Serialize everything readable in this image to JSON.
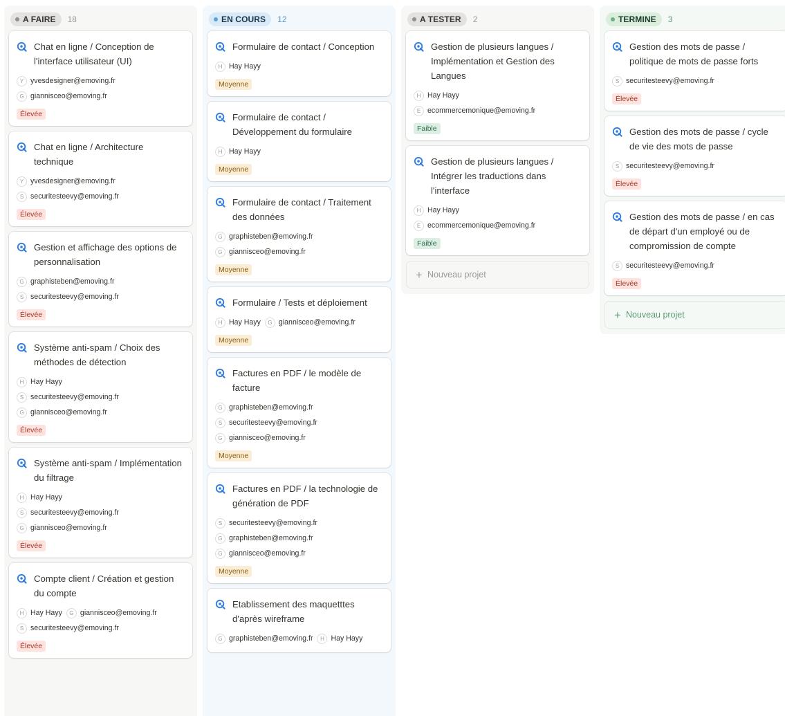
{
  "colors": {
    "task_icon": "#2f7de1",
    "todo": {
      "column_bg": "#f7f7f5",
      "pill_bg": "#e3e2e0",
      "pill_text": "#37352f",
      "dot": "#91918e",
      "count": "#9b9a97"
    },
    "inprogress": {
      "column_bg": "#f3f8fd",
      "pill_bg": "#d8e9f7",
      "pill_text": "#183347",
      "dot": "#5ba3df",
      "count": "#5a95c6"
    },
    "totest": {
      "column_bg": "#f7f7f5",
      "pill_bg": "#e3e2e0",
      "pill_text": "#37352f",
      "dot": "#91918e",
      "count": "#9b9a97"
    },
    "done": {
      "column_bg": "#f5f9f6",
      "pill_bg": "#dbeddb",
      "pill_text": "#1c3829",
      "dot": "#6cb287",
      "count": "#5e9a72"
    }
  },
  "columns": [
    {
      "id": "todo",
      "label": "A FAIRE",
      "count": "18",
      "cards": [
        {
          "title": "Chat en ligne / Conception de l'interface utilisateur (UI)",
          "people": [
            [
              {
                "initial": "Y",
                "name": "yvesdesigner@emoving.fr"
              }
            ],
            [
              {
                "initial": "G",
                "name": "giannisceo@emoving.fr"
              }
            ]
          ],
          "priority": "Élevée",
          "level": "high"
        },
        {
          "title": "Chat en ligne / Architecture technique",
          "people": [
            [
              {
                "initial": "Y",
                "name": "yvesdesigner@emoving.fr"
              }
            ],
            [
              {
                "initial": "S",
                "name": "securitesteevy@emoving.fr"
              }
            ]
          ],
          "priority": "Élevée",
          "level": "high"
        },
        {
          "title": "Gestion et affichage des options de personnalisation",
          "people": [
            [
              {
                "initial": "G",
                "name": "graphisteben@emoving.fr"
              }
            ],
            [
              {
                "initial": "S",
                "name": "securitesteevy@emoving.fr"
              }
            ]
          ],
          "priority": "Élevée",
          "level": "high"
        },
        {
          "title": "Système anti-spam / Choix des méthodes de détection",
          "people": [
            [
              {
                "initial": "H",
                "name": "Hay Hayy"
              }
            ],
            [
              {
                "initial": "S",
                "name": "securitesteevy@emoving.fr"
              }
            ],
            [
              {
                "initial": "G",
                "name": "giannisceo@emoving.fr"
              }
            ]
          ],
          "priority": "Élevée",
          "level": "high"
        },
        {
          "title": "Système anti-spam / Implémentation du filtrage",
          "people": [
            [
              {
                "initial": "H",
                "name": "Hay Hayy"
              }
            ],
            [
              {
                "initial": "S",
                "name": "securitesteevy@emoving.fr"
              }
            ],
            [
              {
                "initial": "G",
                "name": "giannisceo@emoving.fr"
              }
            ]
          ],
          "priority": "Élevée",
          "level": "high"
        },
        {
          "title": "Compte client / Création et gestion du compte",
          "people": [
            [
              {
                "initial": "H",
                "name": "Hay Hayy"
              },
              {
                "initial": "G",
                "name": "giannisceo@emoving.fr"
              }
            ],
            [
              {
                "initial": "S",
                "name": "securitesteevy@emoving.fr"
              }
            ]
          ],
          "priority": "Élevée",
          "level": "high"
        }
      ],
      "new_project": ""
    },
    {
      "id": "inprogress",
      "label": "EN COURS",
      "count": "12",
      "cards": [
        {
          "title": "Formulaire de contact / Conception",
          "people": [
            [
              {
                "initial": "H",
                "name": "Hay Hayy"
              }
            ]
          ],
          "priority": "Moyenne",
          "level": "mid"
        },
        {
          "title": "Formulaire de contact / Développement du formulaire",
          "people": [
            [
              {
                "initial": "H",
                "name": "Hay Hayy"
              }
            ]
          ],
          "priority": "Moyenne",
          "level": "mid"
        },
        {
          "title": "Formulaire de contact / Traitement des données",
          "people": [
            [
              {
                "initial": "G",
                "name": "graphisteben@emoving.fr"
              }
            ],
            [
              {
                "initial": "G",
                "name": "giannisceo@emoving.fr"
              }
            ]
          ],
          "priority": "Moyenne",
          "level": "mid"
        },
        {
          "title": "Formulaire / Tests et déploiement",
          "people": [
            [
              {
                "initial": "H",
                "name": "Hay Hayy"
              },
              {
                "initial": "G",
                "name": "giannisceo@emoving.fr"
              }
            ]
          ],
          "priority": "Moyenne",
          "level": "mid"
        },
        {
          "title": "Factures en PDF / le modèle de facture",
          "people": [
            [
              {
                "initial": "G",
                "name": "graphisteben@emoving.fr"
              }
            ],
            [
              {
                "initial": "S",
                "name": "securitesteevy@emoving.fr"
              }
            ],
            [
              {
                "initial": "G",
                "name": "giannisceo@emoving.fr"
              }
            ]
          ],
          "priority": "Moyenne",
          "level": "mid"
        },
        {
          "title": "Factures en PDF / la technologie de génération de PDF",
          "people": [
            [
              {
                "initial": "S",
                "name": "securitesteevy@emoving.fr"
              }
            ],
            [
              {
                "initial": "G",
                "name": "graphisteben@emoving.fr"
              }
            ],
            [
              {
                "initial": "G",
                "name": "giannisceo@emoving.fr"
              }
            ]
          ],
          "priority": "Moyenne",
          "level": "mid"
        },
        {
          "title": "Etablissement des maquetttes d'après wireframe",
          "people": [
            [
              {
                "initial": "G",
                "name": "graphisteben@emoving.fr"
              },
              {
                "initial": "H",
                "name": "Hay Hayy"
              }
            ]
          ],
          "priority": "",
          "level": ""
        }
      ],
      "new_project": ""
    },
    {
      "id": "totest",
      "label": "A TESTER",
      "count": "2",
      "cards": [
        {
          "title": "Gestion de plusieurs langues / Implémentation et Gestion des Langues",
          "people": [
            [
              {
                "initial": "H",
                "name": "Hay Hayy"
              }
            ],
            [
              {
                "initial": "E",
                "name": "ecommercemonique@emoving.fr"
              }
            ]
          ],
          "priority": "Faible",
          "level": "low"
        },
        {
          "title": "Gestion de plusieurs langues / Intégrer les traductions dans l'interface",
          "people": [
            [
              {
                "initial": "H",
                "name": "Hay Hayy"
              }
            ],
            [
              {
                "initial": "E",
                "name": "ecommercemonique@emoving.fr"
              }
            ]
          ],
          "priority": "Faible",
          "level": "low"
        }
      ],
      "new_project": "Nouveau projet"
    },
    {
      "id": "done",
      "label": "TERMINE",
      "count": "3",
      "cards": [
        {
          "title": "Gestion des mots de passe / politique de mots de passe forts",
          "people": [
            [
              {
                "initial": "S",
                "name": "securitesteevy@emoving.fr"
              }
            ]
          ],
          "priority": "Élevée",
          "level": "high"
        },
        {
          "title": "Gestion des mots de passe / cycle de vie des mots de passe",
          "people": [
            [
              {
                "initial": "S",
                "name": "securitesteevy@emoving.fr"
              }
            ]
          ],
          "priority": "Élevée",
          "level": "high"
        },
        {
          "title": "Gestion des mots de passe / en cas de départ d'un employé ou de compromission de compte",
          "people": [
            [
              {
                "initial": "S",
                "name": "securitesteevy@emoving.fr"
              }
            ]
          ],
          "priority": "Élevée",
          "level": "high"
        }
      ],
      "new_project": "Nouveau projet"
    }
  ]
}
